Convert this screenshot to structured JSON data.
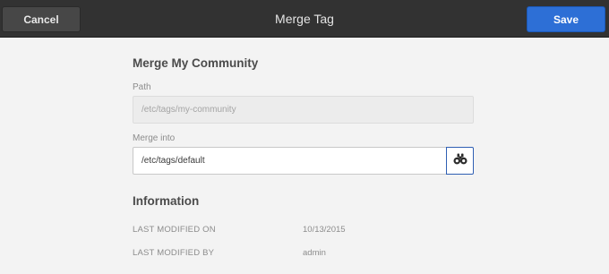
{
  "header": {
    "cancel_label": "Cancel",
    "title": "Merge Tag",
    "save_label": "Save"
  },
  "form": {
    "section_title": "Merge My Community",
    "path_label": "Path",
    "path_value": "/etc/tags/my-community",
    "merge_into_label": "Merge into",
    "merge_into_value": "/etc/tags/default",
    "picker_icon": "binoculars-icon"
  },
  "information": {
    "section_title": "Information",
    "rows": [
      {
        "key": "LAST MODIFIED ON",
        "value": "10/13/2015"
      },
      {
        "key": "LAST MODIFIED BY",
        "value": "admin"
      }
    ]
  },
  "colors": {
    "titlebar": "#323232",
    "save_button": "#2d6fd6",
    "background": "#f3f3f3"
  }
}
